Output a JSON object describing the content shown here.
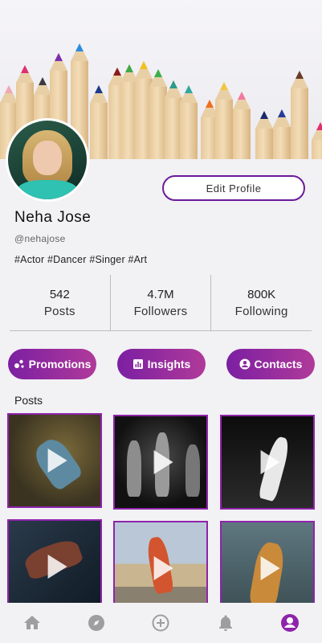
{
  "profile": {
    "name": "Neha Jose",
    "handle": "@nehajose",
    "tags": "#Actor #Dancer #Singer #Art",
    "edit_label": "Edit Profile"
  },
  "stats": [
    {
      "value": "542",
      "label": "Posts"
    },
    {
      "value": "4.7M",
      "label": "Followers"
    },
    {
      "value": "800K",
      "label": "Following"
    }
  ],
  "actions": {
    "promotions": "Promotions",
    "insights": "Insights",
    "contacts": "Contacts"
  },
  "posts_title": "Posts",
  "bottom_nav": [
    "home-icon",
    "explore-icon",
    "add-icon",
    "notifications-icon",
    "profile-icon"
  ],
  "colors": {
    "accent": "#7b1fa2",
    "accent_light": "#b03a9a",
    "nav_active": "#8e24aa",
    "nav_inactive": "#9e9e9e"
  }
}
